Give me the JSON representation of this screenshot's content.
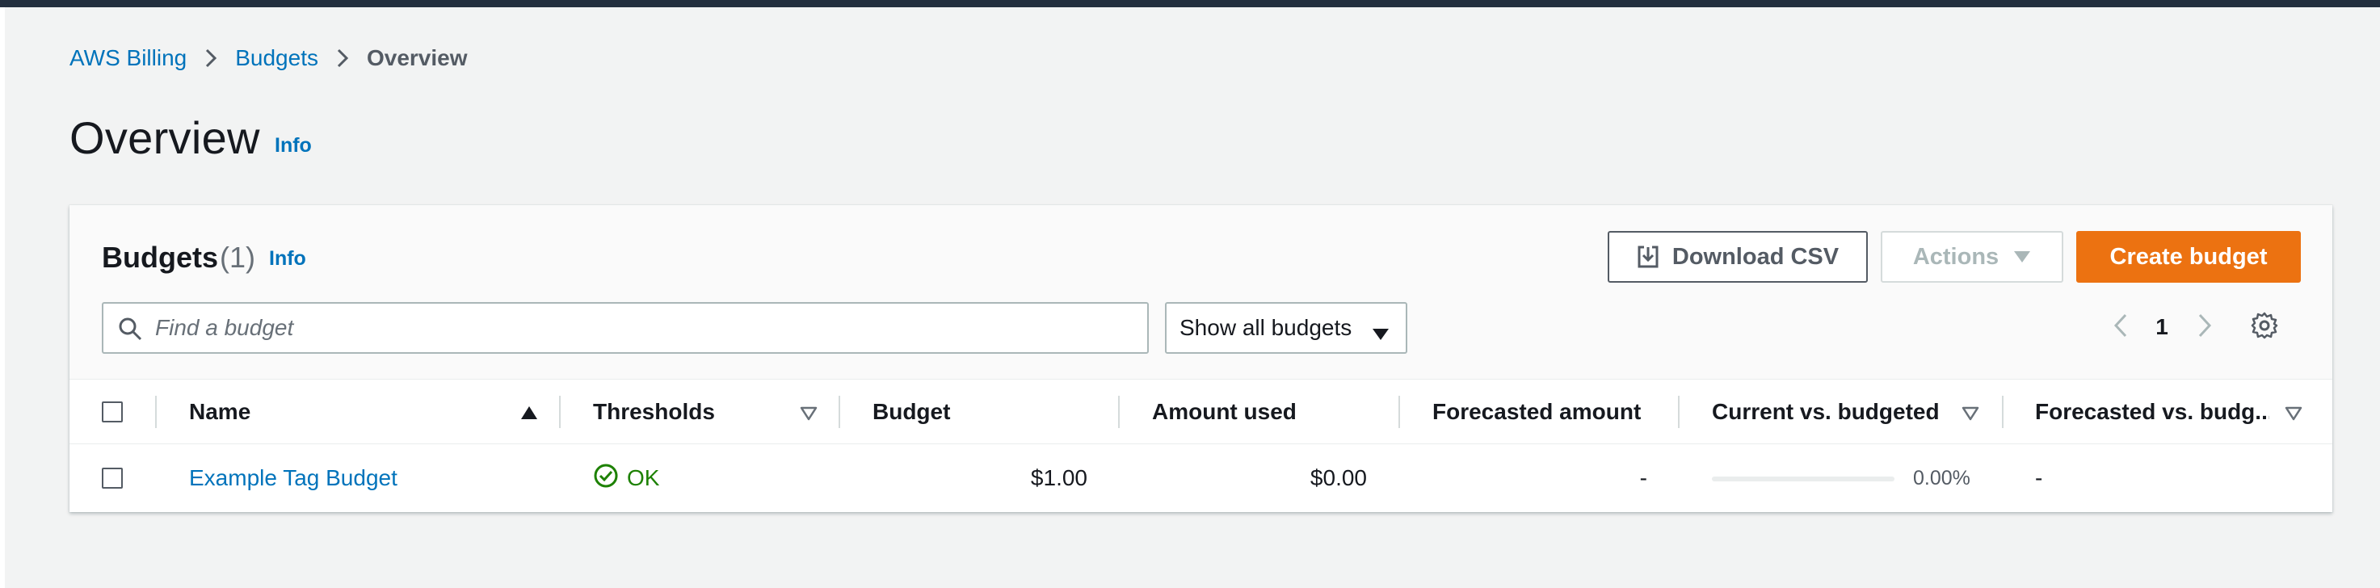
{
  "breadcrumb": {
    "items": [
      {
        "label": "AWS Billing"
      },
      {
        "label": "Budgets"
      },
      {
        "label": "Overview"
      }
    ]
  },
  "page": {
    "title": "Overview",
    "info_label": "Info"
  },
  "budgets_panel": {
    "title": "Budgets",
    "count": "(1)",
    "info_label": "Info",
    "download_csv_label": "Download CSV",
    "actions_label": "Actions",
    "create_label": "Create budget",
    "search": {
      "placeholder": "Find a budget",
      "value": ""
    },
    "filter": {
      "selected": "Show all budgets"
    },
    "pagination": {
      "current_page": "1"
    }
  },
  "table": {
    "columns": [
      {
        "label": "Name",
        "sort": "ascending"
      },
      {
        "label": "Thresholds",
        "sort": "sortable"
      },
      {
        "label": "Budget"
      },
      {
        "label": "Amount used"
      },
      {
        "label": "Forecasted amount"
      },
      {
        "label": "Current vs. budgeted",
        "sort": "sortable"
      },
      {
        "label": "Forecasted vs. budg...",
        "sort": "sortable"
      }
    ],
    "rows": [
      {
        "name": "Example Tag Budget",
        "thresholds": "OK",
        "budget": "$1.00",
        "amount_used": "$0.00",
        "forecasted_amount": "-",
        "current_vs_budgeted": "0.00%",
        "current_vs_budgeted_fraction": 0.0,
        "forecasted_vs_budgeted": "-"
      }
    ]
  },
  "colors": {
    "link": "#0073bb",
    "primary_button": "#ec7211",
    "status_ok": "#1d8102",
    "header_bar": "#232f3e"
  },
  "icons": [
    "chevron-right-icon",
    "search-icon",
    "caret-down-icon",
    "download-icon",
    "chevron-left-icon",
    "settings-gear-icon",
    "sort-ascending-icon",
    "sort-icon",
    "check-circle-icon"
  ]
}
